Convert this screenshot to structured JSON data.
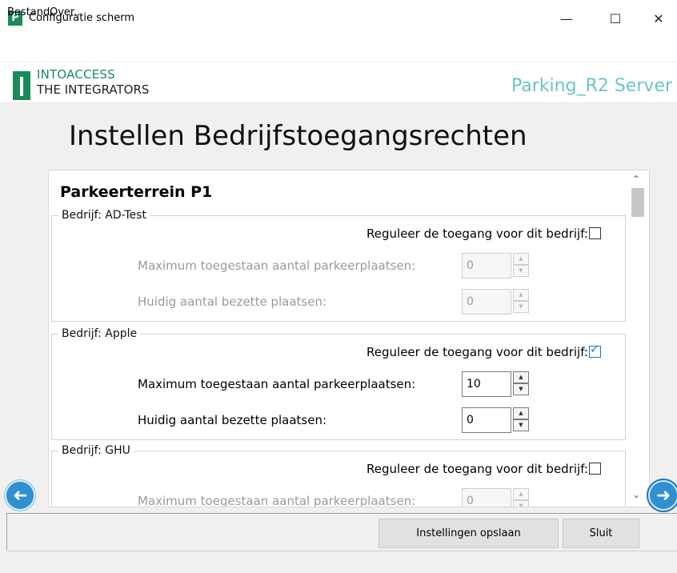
{
  "window": {
    "title": "Configuratie scherm",
    "app_icon": "P",
    "minimize": "—",
    "maximize": "☐",
    "close": "✕"
  },
  "menu": {
    "items": [
      "Bestand",
      "Over.."
    ]
  },
  "brand": {
    "line1": "INTOACCESS",
    "line2": "THE INTEGRATORS",
    "server": "Parking_R2 Server"
  },
  "heading": "Instellen Bedrijfstoegangsrechten",
  "section": {
    "title": "Parkeerterrein P1",
    "companies": [
      {
        "legend": "Bedrijf: AD-Test",
        "regulate_label": "Reguleer de toegang voor dit bedrijf:",
        "regulate_checked": false,
        "max_label": "Maximum toegestaan aantal parkeerplaatsen:",
        "max_value": "0",
        "current_label": "Huidig aantal bezette plaatsen:",
        "current_value": "0"
      },
      {
        "legend": "Bedrijf: Apple",
        "regulate_label": "Reguleer de toegang voor dit bedrijf:",
        "regulate_checked": true,
        "max_label": "Maximum toegestaan aantal parkeerplaatsen:",
        "max_value": "10",
        "current_label": "Huidig aantal bezette plaatsen:",
        "current_value": "0"
      },
      {
        "legend": "Bedrijf: GHU",
        "regulate_label": "Reguleer de toegang voor dit bedrijf:",
        "regulate_checked": false,
        "max_label": "Maximum toegestaan aantal parkeerplaatsen:",
        "max_value": "0"
      }
    ]
  },
  "buttons": {
    "save": "Instellingen opslaan",
    "close": "Sluit"
  },
  "icons": {
    "prev": "arrow-left-icon",
    "next": "arrow-right-icon",
    "scroll_up": "chevron-up-icon",
    "scroll_down": "chevron-down-icon"
  },
  "colors": {
    "brand_green": "#1b8a5a",
    "server_text": "#6cc4c4",
    "accent_blue": "#1a73c8"
  }
}
